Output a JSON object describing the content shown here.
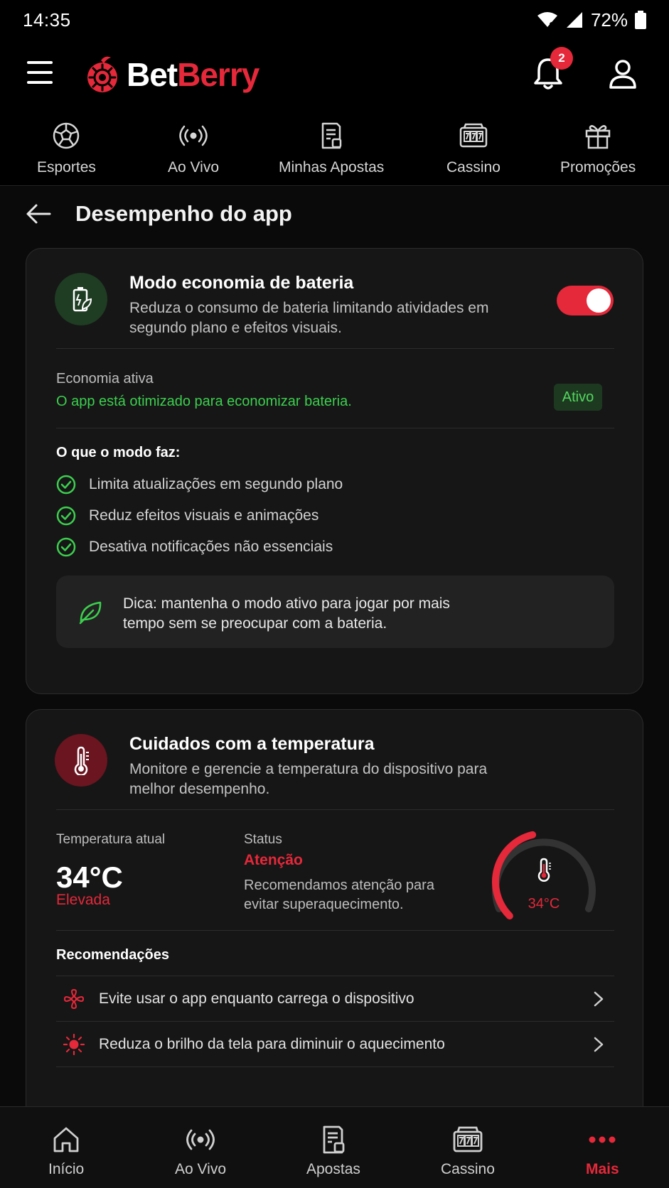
{
  "status_bar": {
    "time": "14:35",
    "battery": "72%"
  },
  "header": {
    "brand_part1": "Bet",
    "brand_part2": "Berry",
    "notification_count": "2"
  },
  "top_nav": [
    {
      "label": "Esportes",
      "icon": "soccer-ball-icon"
    },
    {
      "label": "Ao Vivo",
      "icon": "live-broadcast-icon"
    },
    {
      "label": "Minhas Apostas",
      "icon": "bet-slip-icon"
    },
    {
      "label": "Cassino",
      "icon": "slot-machine-icon"
    },
    {
      "label": "Promoções",
      "icon": "gift-icon"
    }
  ],
  "page": {
    "title": "Desempenho do app"
  },
  "battery_card": {
    "title": "Modo economia de bateria",
    "description": "Reduza o consumo de bateria limitando atividades em segundo plano e efeitos visuais.",
    "toggle_on": true,
    "status_label": "Economia ativa",
    "status_text": "O app está otimizado para economizar bateria.",
    "badge": "Ativo",
    "features_heading": "O que o modo faz:",
    "features": [
      "Limita atualizações em segundo plano",
      "Reduz efeitos visuais e animações",
      "Desativa notificações não essenciais"
    ],
    "tip": "Dica: mantenha o modo ativo para jogar por mais tempo sem se preocupar com a bateria."
  },
  "temperature_card": {
    "title": "Cuidados com a temperatura",
    "description": "Monitore e gerencie a temperatura do dispositivo para melhor desempenho.",
    "current_label": "Temperatura atual",
    "current_value": "34°C",
    "current_level": "Elevada",
    "status_label": "Status",
    "status_value": "Atenção",
    "status_description": "Recomendamos atenção para evitar superaquecimento.",
    "gauge_value": "34°C",
    "gauge_fraction": 0.45,
    "recommendations_heading": "Recomendações",
    "recommendations": [
      {
        "text": "Evite usar o app enquanto carrega o dispositivo",
        "icon": "fan-icon"
      },
      {
        "text": "Reduza o brilho da tela para diminuir o aquecimento",
        "icon": "sun-icon"
      }
    ]
  },
  "bottom_nav": [
    {
      "label": "Início",
      "icon": "home-icon"
    },
    {
      "label": "Ao Vivo",
      "icon": "live-broadcast-icon"
    },
    {
      "label": "Apostas",
      "icon": "bet-slip-icon"
    },
    {
      "label": "Cassino",
      "icon": "slot-machine-icon"
    },
    {
      "label": "Mais",
      "icon": "more-dots-icon",
      "active": true
    }
  ],
  "colors": {
    "accent": "#e5283a",
    "success": "#3ccf4e",
    "background": "#000000",
    "card": "#161616"
  }
}
